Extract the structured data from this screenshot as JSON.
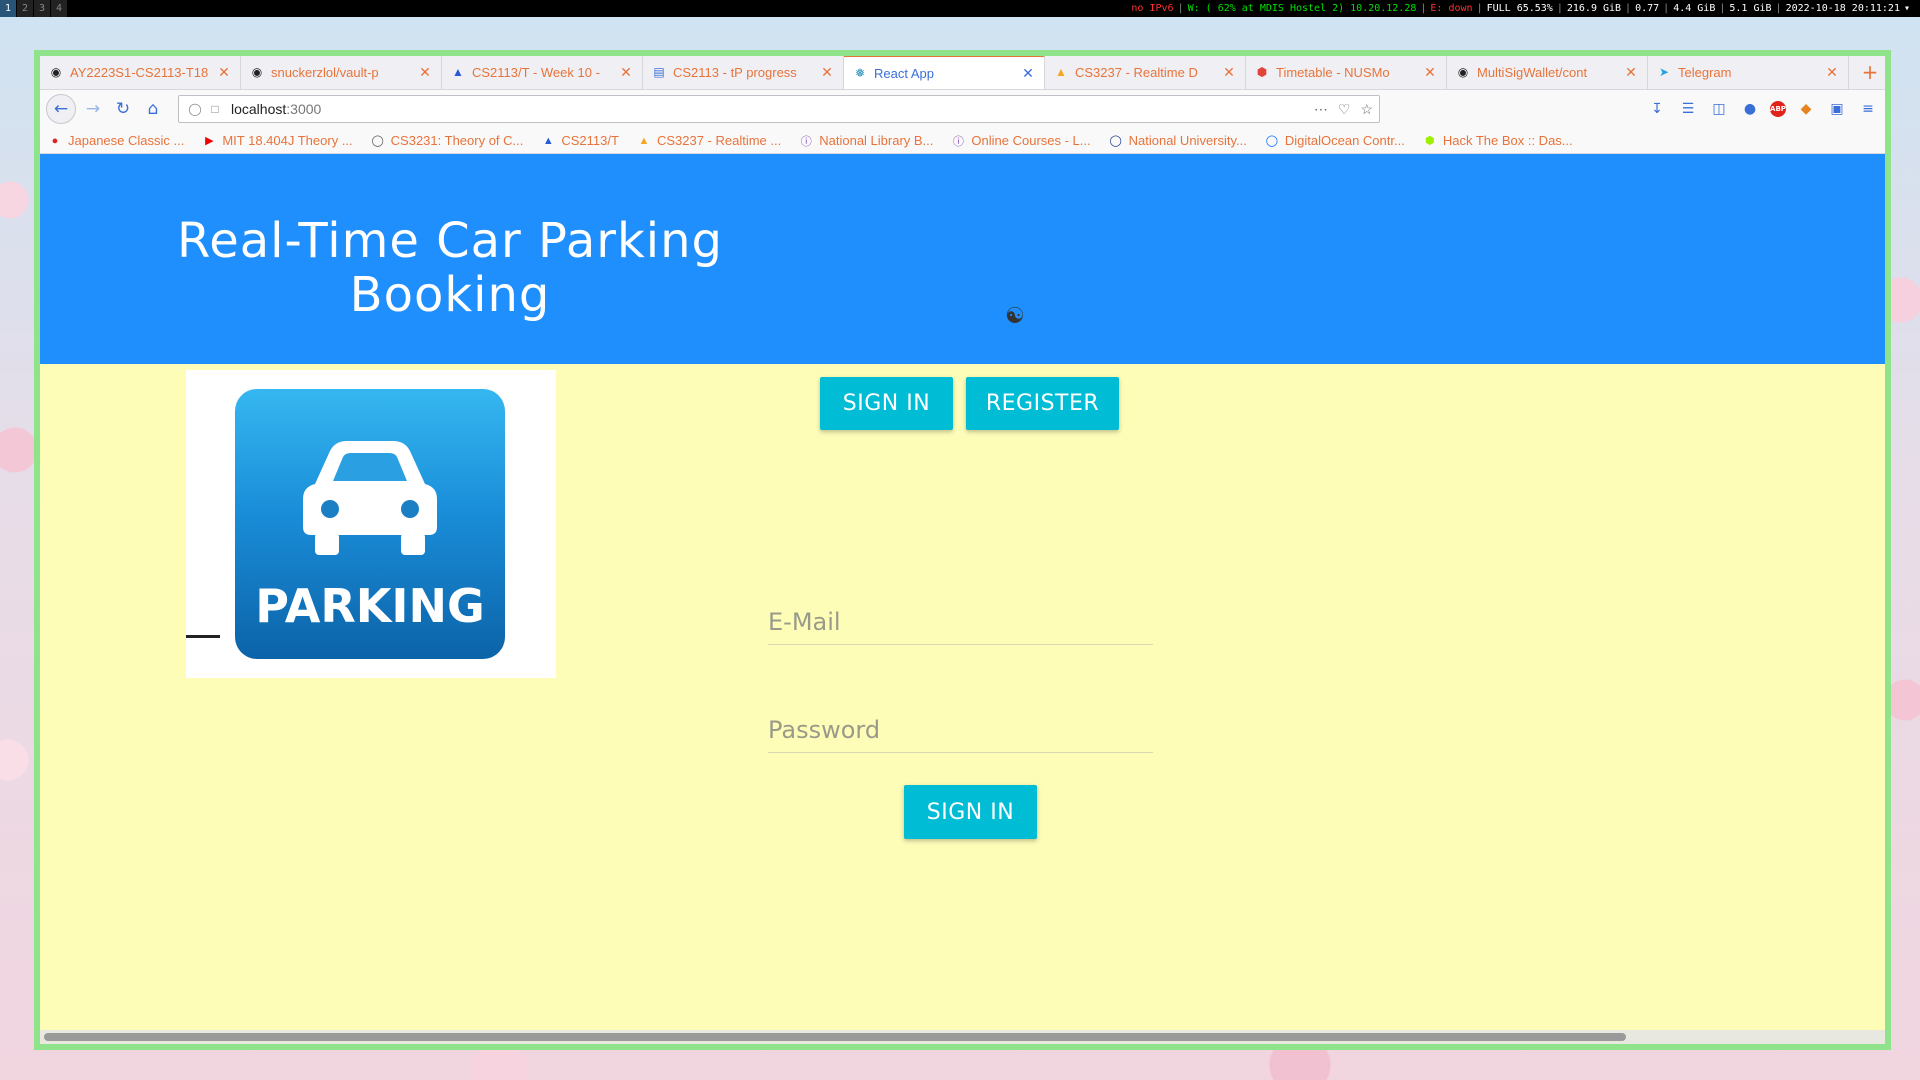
{
  "statusbar": {
    "workspaces": [
      "1",
      "2",
      "3",
      "4"
    ],
    "ipv6": "no IPv6",
    "wifi": "W: ( 62% at MDIS Hostel 2) 10.20.12.28",
    "ethernet": "E: down",
    "battery": "FULL 65.53%",
    "disk": "216.9 GiB",
    "load": "0.77",
    "mem": "4.4 GiB",
    "swap": "5.1 GiB",
    "datetime": "2022-10-18 20:11:21"
  },
  "tabs": [
    {
      "label": "AY2223S1-CS2113-T18",
      "icon": "github-icon"
    },
    {
      "label": "snuckerzlol/vault-p",
      "icon": "github-icon"
    },
    {
      "label": "CS2113/T - Week 10 -",
      "icon": "graduation-cap-icon"
    },
    {
      "label": "CS2113 - tP progress",
      "icon": "document-icon"
    },
    {
      "label": "React App",
      "icon": "react-icon",
      "active": true
    },
    {
      "label": "CS3237 - Realtime D",
      "icon": "firebase-icon"
    },
    {
      "label": "Timetable - NUSMo",
      "icon": "nusmods-icon"
    },
    {
      "label": "MultiSigWallet/cont",
      "icon": "github-icon"
    },
    {
      "label": "Telegram",
      "icon": "telegram-icon"
    }
  ],
  "url": {
    "host": "localhost",
    "port": ":3000"
  },
  "bookmarks": [
    {
      "label": "Japanese Classic ...",
      "icon": "japanese-icon"
    },
    {
      "label": "MIT 18.404J Theory ...",
      "icon": "youtube-icon"
    },
    {
      "label": "CS3231: Theory of C...",
      "icon": "globe-icon"
    },
    {
      "label": "CS2113/T",
      "icon": "graduation-cap-icon"
    },
    {
      "label": "CS3237 - Realtime ...",
      "icon": "firebase-icon"
    },
    {
      "label": "National Library B...",
      "icon": "info-icon"
    },
    {
      "label": "Online Courses - L...",
      "icon": "info-icon"
    },
    {
      "label": "National University...",
      "icon": "nus-icon"
    },
    {
      "label": "DigitalOcean Contr...",
      "icon": "digitalocean-icon"
    },
    {
      "label": "Hack The Box :: Das...",
      "icon": "hackthebox-icon"
    }
  ],
  "app": {
    "title_line1": "Real-Time Car Parking",
    "title_line2": "Booking",
    "logo_text": "PARKING",
    "tab_signin": "SIGN IN",
    "tab_register": "REGISTER",
    "email_placeholder": "E-Mail",
    "password_placeholder": "Password",
    "submit": "SIGN IN"
  },
  "colors": {
    "header": "#1f8ffe",
    "page_bg": "#fdfdb8",
    "button": "#00bcd4",
    "tab_text": "#e8733a",
    "active_tab": "#3a6fd8",
    "window_border": "#8fe38a"
  }
}
